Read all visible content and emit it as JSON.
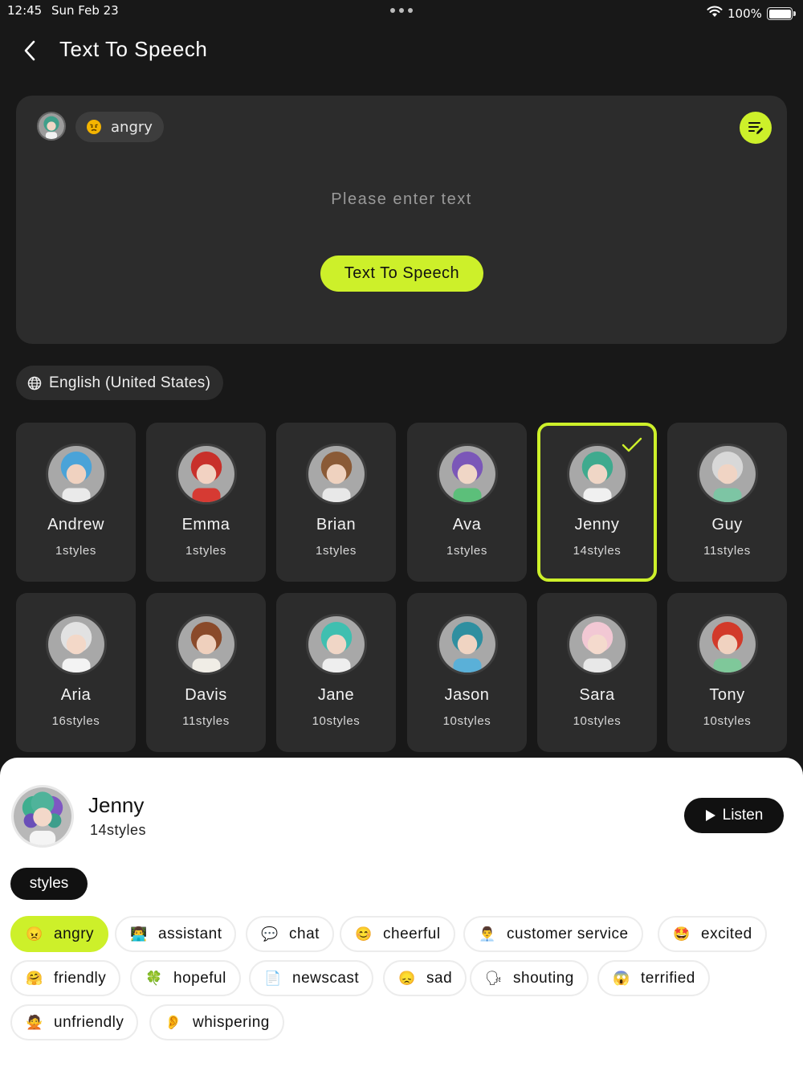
{
  "status_bar": {
    "time": "12:45",
    "date": "Sun Feb 23",
    "battery_pct": "100%"
  },
  "header": {
    "title": "Text To Speech",
    "back_icon": "chevron-left-icon"
  },
  "editor": {
    "selected_style": "angry",
    "placeholder": "Please enter text",
    "value": "",
    "action_label": "Text To Speech",
    "accent": "#cdf02a"
  },
  "language": {
    "label": "English (United States)",
    "icon": "globe-icon"
  },
  "voices": [
    {
      "name": "Andrew",
      "styles": "1styles"
    },
    {
      "name": "Emma",
      "styles": "1styles"
    },
    {
      "name": "Brian",
      "styles": "1styles"
    },
    {
      "name": "Ava",
      "styles": "1styles"
    },
    {
      "name": "Jenny",
      "styles": "14styles",
      "selected": true
    },
    {
      "name": "Guy",
      "styles": "11styles"
    },
    {
      "name": "Aria",
      "styles": "16styles"
    },
    {
      "name": "Davis",
      "styles": "11styles"
    },
    {
      "name": "Jane",
      "styles": "10styles"
    },
    {
      "name": "Jason",
      "styles": "10styles"
    },
    {
      "name": "Sara",
      "styles": "10styles"
    },
    {
      "name": "Tony",
      "styles": "10styles"
    }
  ],
  "sheet": {
    "name": "Jenny",
    "styles": "14styles",
    "listen_label": "Listen",
    "tab_label": "styles",
    "style_options": [
      {
        "label": "angry",
        "emoji": "😠",
        "active": true
      },
      {
        "label": "assistant",
        "emoji": "👨‍💻"
      },
      {
        "label": "chat",
        "emoji": "💬"
      },
      {
        "label": "cheerful",
        "emoji": "😊"
      },
      {
        "label": "customer service",
        "emoji": "👨‍💼"
      },
      {
        "label": "excited",
        "emoji": "🤩"
      },
      {
        "label": "friendly",
        "emoji": "🤗"
      },
      {
        "label": "hopeful",
        "emoji": "🍀"
      },
      {
        "label": "newscast",
        "emoji": "📄"
      },
      {
        "label": "sad",
        "emoji": "😞"
      },
      {
        "label": "shouting",
        "emoji": "🗣"
      },
      {
        "label": "terrified",
        "emoji": "😱"
      },
      {
        "label": "unfriendly",
        "emoji": "🙅"
      },
      {
        "label": "whispering",
        "emoji": "👂"
      }
    ]
  }
}
